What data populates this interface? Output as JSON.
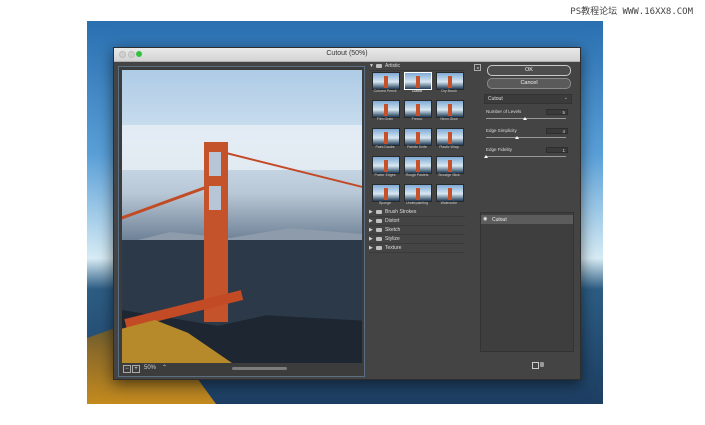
{
  "watermark": "PS教程论坛 WWW.16XX8.COM",
  "window": {
    "title": "Cutout (50%)"
  },
  "preview": {
    "zoom": "50%",
    "zoom_minus": "−",
    "zoom_plus": "+",
    "zoom_caret": "⌃"
  },
  "gallery": {
    "artistic": {
      "label": "Artistic",
      "filters": [
        "Colored Pencil",
        "Cutout",
        "Dry Brush",
        "Film Grain",
        "Fresco",
        "Neon Glow",
        "Paint Daubs",
        "Palette Knife",
        "Plastic Wrap",
        "Poster Edges",
        "Rough Pastels",
        "Smudge Stick",
        "Sponge",
        "Underpainting",
        "Watercolor"
      ],
      "selected": "Cutout"
    },
    "groups": [
      "Brush Strokes",
      "Distort",
      "Sketch",
      "Stylize",
      "Texture"
    ]
  },
  "settings": {
    "ok": "OK",
    "cancel": "Cancel",
    "filter_select": "Cutout",
    "params": [
      {
        "label": "Number of Levels",
        "value": "5",
        "slider": 0.5
      },
      {
        "label": "Edge Simplicity",
        "value": "4",
        "slider": 0.4
      },
      {
        "label": "Edge Fidelity",
        "value": "1",
        "slider": 0.0
      }
    ]
  },
  "layers": [
    {
      "name": "Cutout"
    }
  ],
  "icons": [
    "close-icon",
    "minimize-icon",
    "zoom-icon",
    "folder-icon",
    "eye-icon",
    "new-layer-icon",
    "trash-icon",
    "collapse-icon"
  ]
}
